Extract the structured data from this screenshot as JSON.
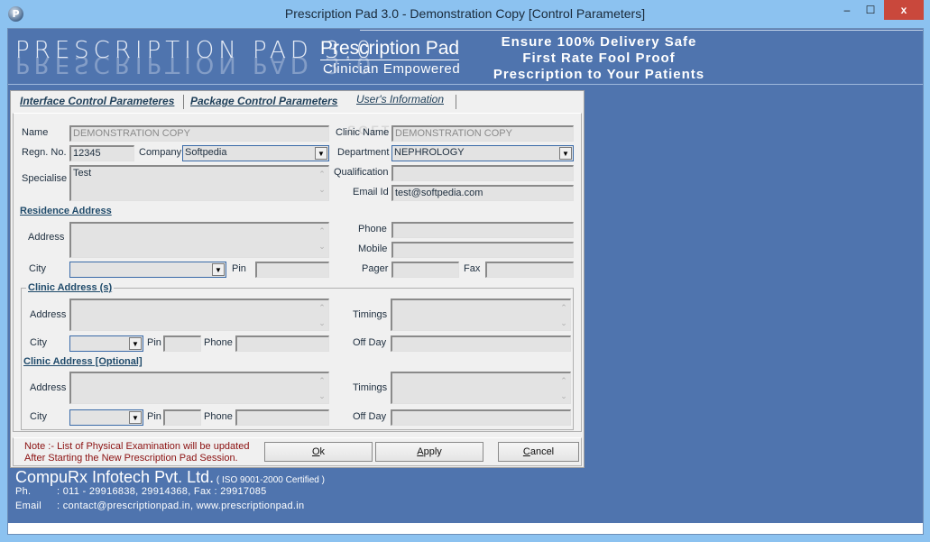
{
  "window": {
    "title": "Prescription Pad 3.0 - Demonstration Copy   [Control Parameters]",
    "app_icon": "P",
    "controls": {
      "minimize": "–",
      "maximize": "☐",
      "close": "x"
    }
  },
  "banner": {
    "logo": "PRESCRIPTION PAD 3.0",
    "brand": "Prescription Pad",
    "brand_sub": "Clinician Empowered",
    "tagline": [
      "Ensure 100% Delivery Safe",
      "First Rate Fool Proof",
      "Prescription to Your Patients"
    ]
  },
  "tabs": [
    {
      "label": "Interface Control Parameteres",
      "active": false
    },
    {
      "label": "Package Control Parameters",
      "active": false
    },
    {
      "label": "User's Information",
      "active": true
    }
  ],
  "form": {
    "name": {
      "label": "Name",
      "value": "DEMONSTRATION COPY"
    },
    "regn_no": {
      "label": "Regn. No.",
      "value": "12345"
    },
    "company": {
      "label": "Company",
      "value": "Softpedia"
    },
    "specialise": {
      "label": "Specialise",
      "value": "Test"
    },
    "clinic_name": {
      "label": "Clinic Name",
      "value": "DEMONSTRATION COPY"
    },
    "department": {
      "label": "Department",
      "value": "NEPHROLOGY"
    },
    "qualification": {
      "label": "Qualification",
      "value": ""
    },
    "email": {
      "label": "Email Id",
      "value": "test@softpedia.com"
    },
    "residence": {
      "heading": "Residence Address",
      "address_label": "Address",
      "address": "",
      "city_label": "City",
      "city": "",
      "pin_label": "Pin",
      "pin": "",
      "phone_label": "Phone",
      "phone": "",
      "mobile_label": "Mobile",
      "mobile": "",
      "pager_label": "Pager",
      "pager": "",
      "fax_label": "Fax",
      "fax": ""
    },
    "clinic": {
      "heading": "Clinic Address (s)",
      "address_label": "Address",
      "city_label": "City",
      "pin_label": "Pin",
      "phone_label": "Phone",
      "timings_label": "Timings",
      "offday_label": "Off Day"
    },
    "clinic_optional": {
      "heading": "Clinic Address [Optional]",
      "address_label": "Address",
      "city_label": "City",
      "pin_label": "Pin",
      "phone_label": "Phone",
      "timings_label": "Timings",
      "offday_label": "Off Day"
    }
  },
  "footer": {
    "note_line1": "Note :- List of Physical Examination will be updated",
    "note_line2": "After  Starting  the  New  Prescription Pad  Session.",
    "ok_accel": "O",
    "ok_rest": "k",
    "apply_accel": "A",
    "apply_rest": "pply",
    "cancel_accel": "C",
    "cancel_rest": "ancel"
  },
  "company": {
    "name": "CompuRx Infotech Pvt. Ltd.",
    "iso": " ( ISO 9001-2000 Certified )",
    "phone_label": "Ph.",
    "phone": ": 011 - 29916838, 29914368,  Fax : 29917085",
    "email_label": "Email",
    "email": ": contact@prescriptionpad.in, www.prescriptionpad.in"
  },
  "watermark": "SOFTPEDIA"
}
